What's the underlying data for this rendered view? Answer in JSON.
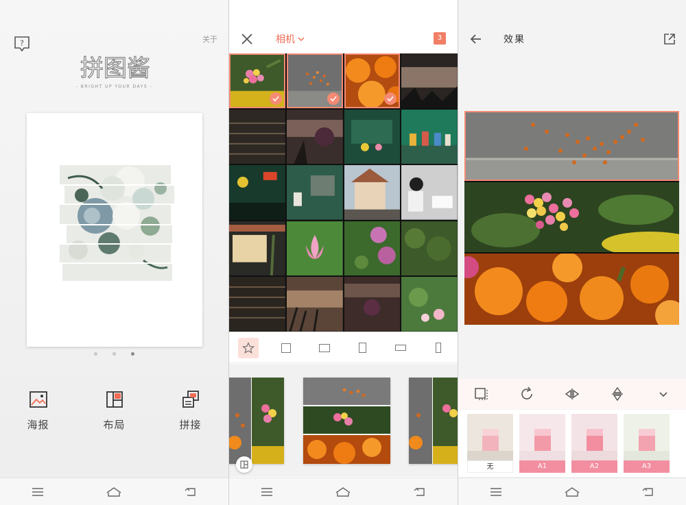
{
  "screen1": {
    "about_label": "关于",
    "logo_text": "拼图酱",
    "tagline": "- BRIGHT UP YOUR DAYS -",
    "menu": [
      {
        "label": "海报",
        "icon": "poster-icon"
      },
      {
        "label": "布局",
        "icon": "layout-icon"
      },
      {
        "label": "拼接",
        "icon": "stitch-icon"
      }
    ],
    "page_dots": 3,
    "active_dot": 2
  },
  "screen2": {
    "album_label": "相机",
    "selected_count": "3",
    "shapes": [
      "favorite",
      "square",
      "landscape",
      "portrait",
      "wide",
      "tall"
    ]
  },
  "screen3": {
    "title": "效果",
    "tools": [
      "border-icon",
      "rotate-icon",
      "flip-horizontal-icon",
      "flip-vertical-icon",
      "collapse-icon"
    ],
    "filters": [
      {
        "name": "无"
      },
      {
        "name": "A1"
      },
      {
        "name": "A2"
      },
      {
        "name": "A3"
      }
    ]
  },
  "colors": {
    "accent": "#f06d54",
    "selection": "#f48a73",
    "filter_label": "#f28ea0"
  }
}
